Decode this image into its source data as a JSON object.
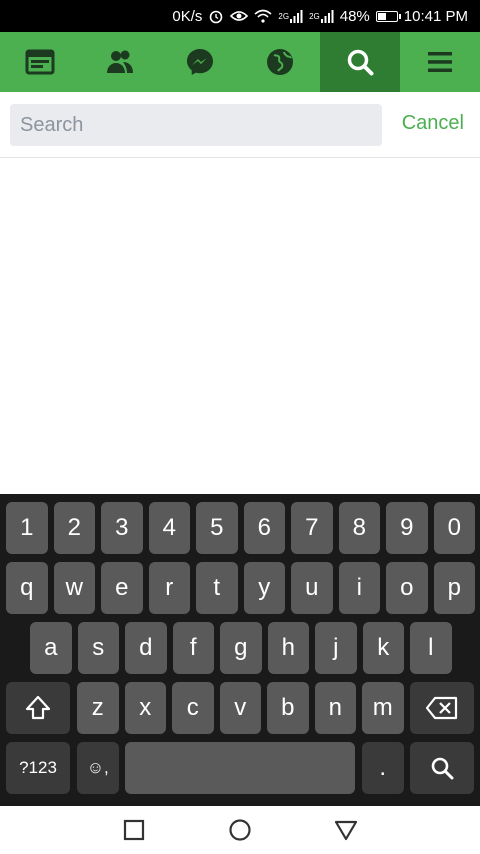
{
  "status_bar": {
    "speed": "0K/s",
    "network_1": "2G",
    "network_2": "2G",
    "battery_text": "48%",
    "battery_level": 0.48,
    "time": "10:41 PM"
  },
  "nav": {
    "items": [
      {
        "icon": "news-feed-icon",
        "active": false
      },
      {
        "icon": "friends-icon",
        "active": false
      },
      {
        "icon": "messenger-icon",
        "active": false
      },
      {
        "icon": "globe-notifications-icon",
        "active": false
      },
      {
        "icon": "search-icon",
        "active": true
      },
      {
        "icon": "menu-icon",
        "active": false
      }
    ]
  },
  "search": {
    "placeholder": "Search",
    "value": "",
    "cancel_label": "Cancel"
  },
  "keyboard": {
    "row_numbers": [
      "1",
      "2",
      "3",
      "4",
      "5",
      "6",
      "7",
      "8",
      "9",
      "0"
    ],
    "row_1": [
      "q",
      "w",
      "e",
      "r",
      "t",
      "y",
      "u",
      "i",
      "o",
      "p"
    ],
    "row_2": [
      "a",
      "s",
      "d",
      "f",
      "g",
      "h",
      "j",
      "k",
      "l"
    ],
    "row_3": [
      "z",
      "x",
      "c",
      "v",
      "b",
      "n",
      "m"
    ],
    "symbols_label": "?123",
    "emoji_comma_label": "☺,",
    "period_label": ".",
    "shift_icon": "shift-icon",
    "backspace_icon": "backspace-icon",
    "search_icon": "search-icon"
  },
  "colors": {
    "brand_green": "#4caf50",
    "active_green": "#2e7d32"
  }
}
